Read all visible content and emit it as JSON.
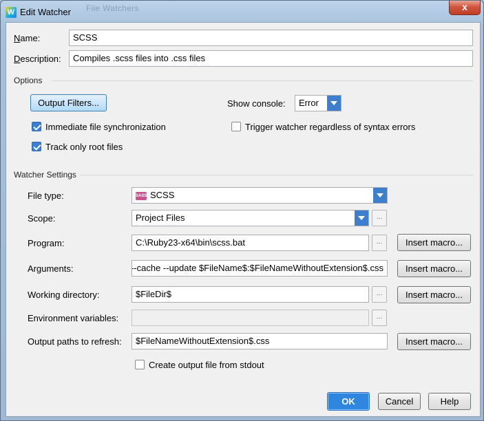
{
  "window": {
    "title": "Edit Watcher",
    "app_icon_letter": "W",
    "background_text": "File Watchers",
    "close_glyph": "x"
  },
  "name": {
    "label": "Name:",
    "value": "SCSS"
  },
  "description": {
    "label": "Description:",
    "value": "Compiles .scss files into .css files"
  },
  "options": {
    "section_title": "Options",
    "output_filters_button": "Output Filters...",
    "show_console_label": "Show console:",
    "show_console_value": "Error",
    "immediate_sync": {
      "label": "Immediate file synchronization",
      "checked": true
    },
    "track_root": {
      "label": "Track only root files",
      "checked": true
    },
    "trigger_regardless": {
      "label": "Trigger watcher regardless of syntax errors",
      "checked": false
    }
  },
  "watcher_settings": {
    "section_title": "Watcher Settings",
    "file_type": {
      "label": "File type:",
      "value": "SCSS",
      "icon": "sass-icon",
      "icon_text": "SASS"
    },
    "scope": {
      "label": "Scope:",
      "value": "Project Files"
    },
    "program": {
      "label": "Program:",
      "value": "C:\\Ruby23-x64\\bin\\scss.bat"
    },
    "arguments": {
      "label": "Arguments:",
      "value": "--cache --update $FileName$:$FileNameWithoutExtension$.css"
    },
    "working_directory": {
      "label": "Working directory:",
      "value": "$FileDir$"
    },
    "environment_variables": {
      "label": "Environment variables:",
      "value": ""
    },
    "output_paths": {
      "label": "Output paths to refresh:",
      "value": "$FileNameWithoutExtension$.css"
    },
    "create_output_from_stdout": {
      "label": "Create output file from stdout",
      "checked": false
    },
    "insert_macro_label": "Insert macro...",
    "ellipsis_label": "..."
  },
  "buttons": {
    "ok": "OK",
    "cancel": "Cancel",
    "help": "Help"
  },
  "colors": {
    "accent": "#3d7fcd",
    "ok_button": "#2e86de",
    "sass_icon": "#c6538c"
  }
}
